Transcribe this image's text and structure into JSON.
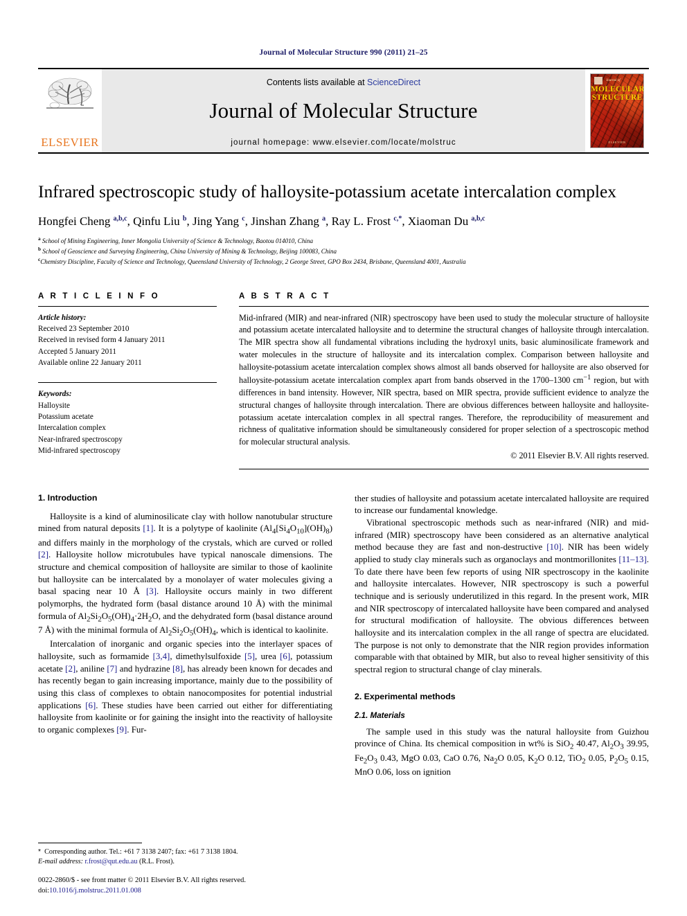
{
  "running_head": "Journal of Molecular Structure 990 (2011) 21–25",
  "masthead": {
    "publisher_name": "ELSEVIER",
    "contents_prefix": "Contents lists available at ",
    "contents_link": "ScienceDirect",
    "journal_title": "Journal of Molecular Structure",
    "homepage": "journal homepage: www.elsevier.com/locate/molstruc",
    "cover": {
      "line1": "MOLECULAR",
      "line2": "STRUCTURE",
      "kicker": "Journal of",
      "footer": "ELSEVIER"
    },
    "link_color": "#2a3a9e",
    "brand_color": "#E87722"
  },
  "article": {
    "title": "Infrared spectroscopic study of halloysite-potassium acetate intercalation complex",
    "authors_html": "Hongfei Cheng <sup>a,b,c</sup>, Qinfu Liu <sup>b</sup>, Jing Yang <sup>c</sup>, Jinshan Zhang <sup>a</sup>, Ray L. Frost <sup>c,</sup><sup class=\"star\">*</sup>, Xiaoman Du <sup>a,b,c</sup>",
    "affiliations": [
      "School of Mining Engineering, Inner Mongolia University of Science & Technology, Baotou 014010, China",
      "School of Geoscience and Surveying Engineering, China University of Mining & Technology, Beijing 100083, China",
      "Chemistry Discipline, Faculty of Science and Technology, Queensland University of Technology, 2 George Street, GPO Box 2434, Brisbane, Queensland 4001, Australia"
    ],
    "affiliation_marks": [
      "a",
      "b",
      "c"
    ]
  },
  "article_info": {
    "heading": "A R T I C L E    I N F O",
    "history_label": "Article history:",
    "history": [
      "Received 23 September 2010",
      "Received in revised form 4 January 2011",
      "Accepted 5 January 2011",
      "Available online 22 January 2011"
    ],
    "keywords_label": "Keywords:",
    "keywords": [
      "Halloysite",
      "Potassium acetate",
      "Intercalation complex",
      "Near-infrared spectroscopy",
      "Mid-infrared spectroscopy"
    ]
  },
  "abstract": {
    "heading": "A B S T R A C T",
    "text_html": "Mid-infrared (MIR) and near-infrared (NIR) spectroscopy have been used to study the molecular structure of halloysite and potassium acetate intercalated halloysite and to determine the structural changes of halloysite through intercalation. The MIR spectra show all fundamental vibrations including the hydroxyl units, basic aluminosilicate framework and water molecules in the structure of halloysite and its intercalation complex. Comparison between halloysite and halloysite-potassium acetate intercalation complex shows almost all bands observed for halloysite are also observed for halloysite-potassium acetate intercalation complex apart from bands observed in the 1700–1300 cm<sup>−1</sup> region, but with differences in band intensity. However, NIR spectra, based on MIR spectra, provide sufficient evidence to analyze the structural changes of halloysite through intercalation. There are obvious differences between halloysite and halloysite-potassium acetate intercalation complex in all spectral ranges. Therefore, the reproducibility of measurement and richness of qualitative information should be simultaneously considered for proper selection of a spectroscopic method for molecular structural analysis.",
    "copyright": "© 2011 Elsevier B.V. All rights reserved."
  },
  "sections": {
    "intro_heading": "1. Introduction",
    "experimental_heading": "2. Experimental methods",
    "materials_heading": "2.1. Materials"
  },
  "body": {
    "left": [
      "Halloysite is a kind of aluminosilicate clay with hollow nanotubular structure mined from natural deposits <span class=\"ref\">[1]</span>. It is a polytype of kaolinite (Al<sub>4</sub>[Si<sub>4</sub>O<sub>10</sub>](OH)<sub>8</sub>) and differs mainly in the morphology of the crystals, which are curved or rolled <span class=\"ref\">[2]</span>. Halloysite hollow microtubules have typical nanoscale dimensions. The structure and chemical composition of halloysite are similar to those of kaolinite but halloysite can be intercalated by a monolayer of water molecules giving a basal spacing near 10 Å <span class=\"ref\">[3]</span>. Halloysite occurs mainly in two different polymorphs, the hydrated form (basal distance around 10 Å) with the minimal formula of Al<sub>2</sub>Si<sub>2</sub>O<sub>5</sub>(OH)<sub>4</sub>·2H<sub>2</sub>O, and the dehydrated form (basal distance around 7 Å) with the minimal formula of Al<sub>2</sub>Si<sub>2</sub>O<sub>5</sub>(OH)<sub>4</sub>, which is identical to kaolinite.",
      "Intercalation of inorganic and organic species into the interlayer spaces of halloysite, such as formamide <span class=\"ref\">[3,4]</span>, dimethylsulfoxide <span class=\"ref\">[5]</span>, urea <span class=\"ref\">[6]</span>, potassium acetate <span class=\"ref\">[2]</span>, aniline <span class=\"ref\">[7]</span> and hydrazine <span class=\"ref\">[8]</span>, has already been known for decades and has recently began to gain increasing importance, mainly due to the possibility of using this class of complexes to obtain nanocomposites for potential industrial applications <span class=\"ref\">[6]</span>. These studies have been carried out either for differentiating halloysite from kaolinite or for gaining the insight into the reactivity of halloysite to organic complexes <span class=\"ref\">[9]</span>. Fur-"
    ],
    "right_continuation": "ther studies of halloysite and potassium acetate intercalated halloysite are required to increase our fundamental knowledge.",
    "right": [
      "Vibrational spectroscopic methods such as near-infrared (NIR) and mid-infrared (MIR) spectroscopy have been considered as an alternative analytical method because they are fast and non-destructive <span class=\"ref\">[10]</span>. NIR has been widely applied to study clay minerals such as organoclays and montmorillonites <span class=\"ref\">[11–13]</span>. To date there have been few reports of using NIR spectroscopy in the kaolinite and halloysite intercalates. However, NIR spectroscopy is such a powerful technique and is seriously underutilized in this regard. In the present work, MIR and NIR spectroscopy of intercalated halloysite have been compared and analysed for structural modification of halloysite. The obvious differences between halloysite and its intercalation complex in the all range of spectra are elucidated. The purpose is not only to demonstrate that the NIR region provides information comparable with that obtained by MIR, but also to reveal higher sensitivity of this spectral region to structural change of clay minerals."
    ],
    "materials_para": "The sample used in this study was the natural halloysite from Guizhou province of China. Its chemical composition in wt% is SiO<sub>2</sub> 40.47, Al<sub>2</sub>O<sub>3</sub> 39.95, Fe<sub>2</sub>O<sub>3</sub> 0.43, MgO 0.03, CaO 0.76, Na<sub>2</sub>O 0.05, K<sub>2</sub>O 0.12, TiO<sub>2</sub> 0.05, P<sub>2</sub>O<sub>5</sub> 0.15, MnO 0.06, loss on ignition"
  },
  "footnote": {
    "corresponding_html": "<span style=\"font-family:'Liberation Sans',sans-serif\">*</span>&nbsp; Corresponding author. Tel.: +61 7 3138 2407; fax: +61 7 3138 1804.",
    "email_html": "<span class=\"ital\">E-mail address:</span> <span class=\"fn-mail\">r.frost@qut.edu.au</span> (R.L. Frost)."
  },
  "imprint": {
    "line1": "0022-2860/$ - see front matter © 2011 Elsevier B.V. All rights reserved.",
    "doi_prefix": "doi:",
    "doi": "10.1016/j.molstruc.2011.01.008"
  }
}
